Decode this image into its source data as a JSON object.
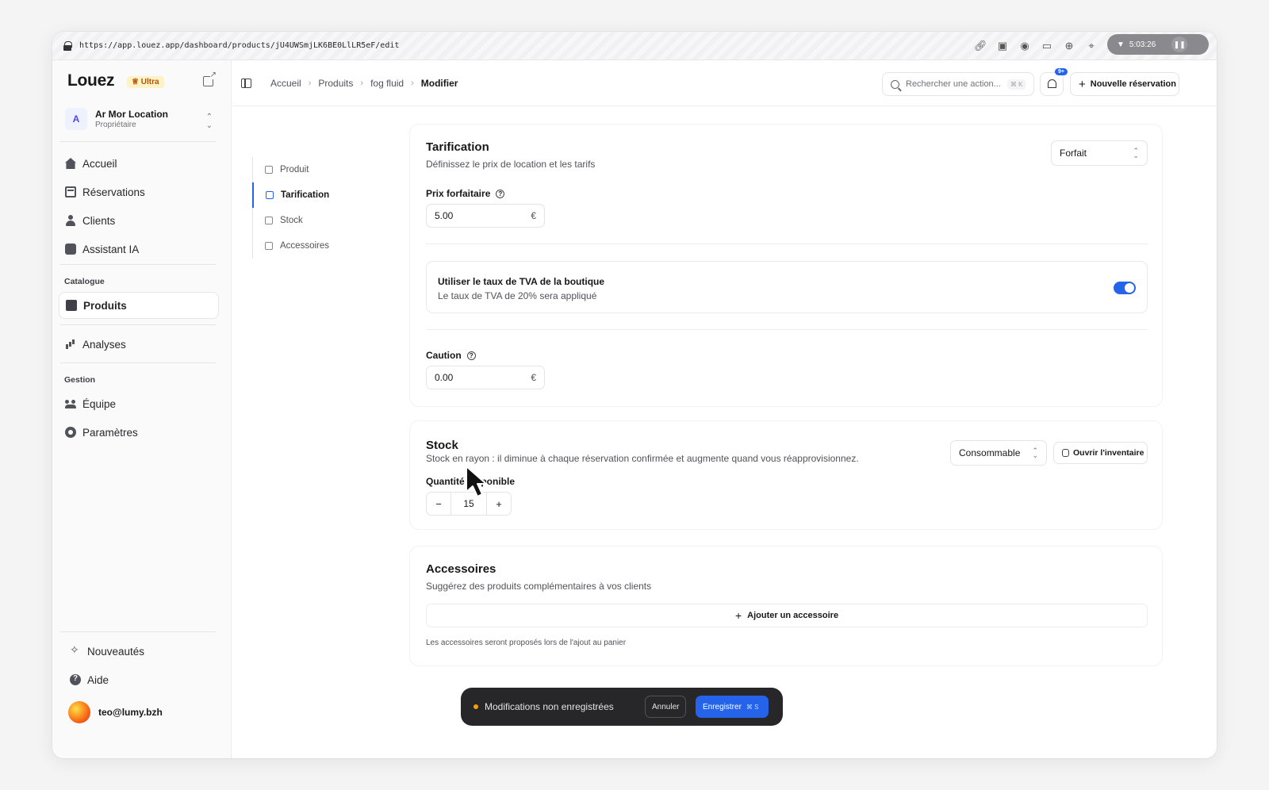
{
  "browser": {
    "url": "https://app.louez.app/dashboard/products/jU4UWSmjLK6BE0LlLR5eF/edit",
    "timer": "5:03:26"
  },
  "sidebar": {
    "brand": "Louez",
    "plan_badge": "Ultra",
    "org": {
      "initial": "A",
      "name": "Ar Mor Location",
      "role": "Propriétaire"
    },
    "main_items": [
      {
        "label": "Accueil",
        "icon": "home-icon"
      },
      {
        "label": "Réservations",
        "icon": "calendar-icon"
      },
      {
        "label": "Clients",
        "icon": "users-icon"
      },
      {
        "label": "Assistant IA",
        "icon": "bot-icon"
      }
    ],
    "catalogue_label": "Catalogue",
    "catalogue_items": [
      {
        "label": "Produits",
        "icon": "package-icon",
        "active": true
      },
      {
        "label": "Analyses",
        "icon": "chart-icon"
      }
    ],
    "gestion_label": "Gestion",
    "gestion_items": [
      {
        "label": "Équipe",
        "icon": "team-icon"
      },
      {
        "label": "Paramètres",
        "icon": "gear-icon"
      }
    ],
    "footer_items": [
      {
        "label": "Nouveautés",
        "icon": "sparkles-icon"
      },
      {
        "label": "Aide",
        "icon": "help-icon"
      }
    ],
    "user_email": "teo@lumy.bzh"
  },
  "header": {
    "breadcrumb": [
      "Accueil",
      "Produits",
      "fog fluid",
      "Modifier"
    ],
    "search_placeholder": "Rechercher une action...",
    "search_shortcut": "⌘ K",
    "notification_count": "9+",
    "new_reservation": "Nouvelle réservation"
  },
  "section_nav": [
    "Produit",
    "Tarification",
    "Stock",
    "Accessoires"
  ],
  "tarification": {
    "title": "Tarification",
    "subtitle": "Définissez le prix de location et les tarifs",
    "pricing_mode": "Forfait",
    "flat_price_label": "Prix forfaitaire",
    "flat_price_value": "5.00",
    "currency": "€",
    "tva_title": "Utiliser le taux de TVA de la boutique",
    "tva_subtitle": "Le taux de TVA de 20% sera appliqué",
    "tva_enabled": true,
    "deposit_label": "Caution",
    "deposit_value": "0.00"
  },
  "stock": {
    "title": "Stock",
    "subtitle": "Stock en rayon : il diminue à chaque réservation confirmée et augmente quand vous réapprovisionnez.",
    "mode": "Consommable",
    "open_inventory": "Ouvrir l'inventaire",
    "quantity_label": "Quantité disponible",
    "quantity_value": "15",
    "minus": "−",
    "plus": "+"
  },
  "accessoires": {
    "title": "Accessoires",
    "subtitle": "Suggérez des produits complémentaires à vos clients",
    "add_button": "Ajouter un accessoire",
    "note": "Les accessoires seront proposés lors de l'ajout au panier"
  },
  "unsaved_bar": {
    "message": "Modifications non enregistrées",
    "cancel": "Annuler",
    "save": "Enregistrer",
    "save_shortcut": "⌘ S"
  },
  "colors": {
    "accent": "#2563eb",
    "warning_dot": "#f59e0b",
    "bar_bg": "#27272a"
  }
}
